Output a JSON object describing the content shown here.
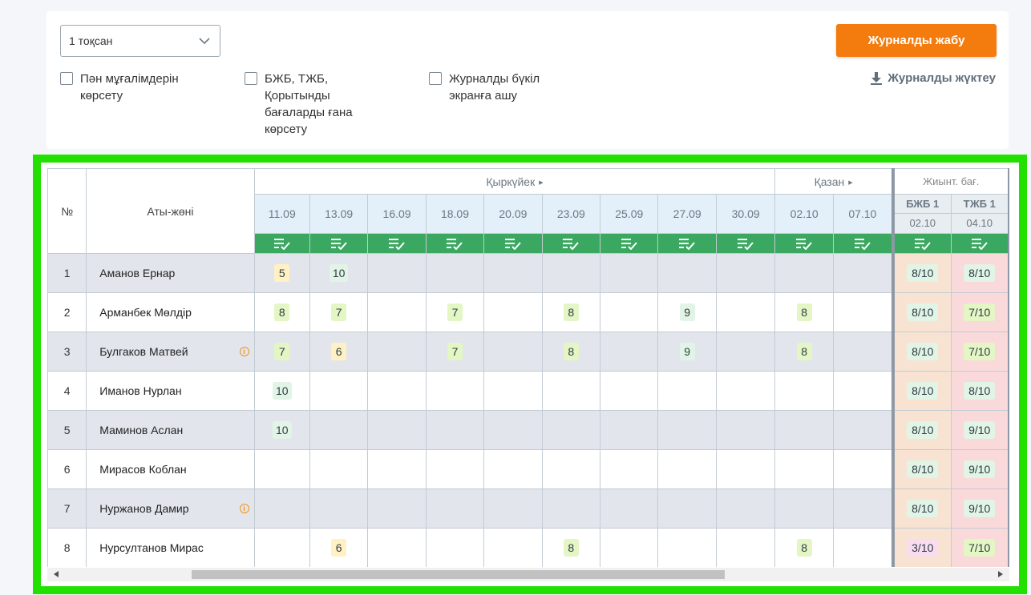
{
  "filters": {
    "quarter": "1 тоқсан",
    "checkboxes": [
      {
        "lines": [
          "Пән мұғалімдерін",
          "көрсету"
        ]
      },
      {
        "lines": [
          "БЖБ, ТЖБ,",
          "Қорытынды",
          "бағаларды ғана",
          "көрсету"
        ]
      },
      {
        "lines": [
          "Журналды бүкіл",
          "экранға ашу"
        ]
      }
    ],
    "close_label": "Журналды жабу",
    "download_label": "Журналды жүктеу"
  },
  "table": {
    "col_num": "№",
    "col_name": "Аты-жөні",
    "months": [
      "Қыркүйек",
      "Қазан"
    ],
    "dates": [
      "11.09",
      "13.09",
      "16.09",
      "18.09",
      "20.09",
      "23.09",
      "25.09",
      "27.09",
      "30.09",
      "02.10",
      "07.10"
    ],
    "summary_title": "Жиынт. бағ.",
    "summary_cols": [
      {
        "label": "БЖБ 1",
        "date": "02.10"
      },
      {
        "label": "ТЖБ 1",
        "date": "04.10"
      }
    ],
    "rows": [
      {
        "n": "1",
        "name": "Аманов Ернар",
        "info": false,
        "grades": [
          "5",
          "10",
          "",
          "",
          "",
          "",
          "",
          "",
          "",
          "",
          ""
        ],
        "bjb": "8/10",
        "tjb": "8/10"
      },
      {
        "n": "2",
        "name": "Арманбек Мөлдір",
        "info": false,
        "grades": [
          "8",
          "7",
          "",
          "7",
          "",
          "8",
          "",
          "9",
          "",
          "8",
          ""
        ],
        "bjb": "8/10",
        "tjb": "7/10"
      },
      {
        "n": "3",
        "name": "Булгаков Матвей",
        "info": true,
        "grades": [
          "7",
          "6",
          "",
          "7",
          "",
          "8",
          "",
          "9",
          "",
          "8",
          ""
        ],
        "bjb": "8/10",
        "tjb": "7/10"
      },
      {
        "n": "4",
        "name": "Иманов Нурлан",
        "info": false,
        "grades": [
          "10",
          "",
          "",
          "",
          "",
          "",
          "",
          "",
          "",
          "",
          ""
        ],
        "bjb": "8/10",
        "tjb": "8/10"
      },
      {
        "n": "5",
        "name": "Маминов Аслан",
        "info": false,
        "grades": [
          "10",
          "",
          "",
          "",
          "",
          "",
          "",
          "",
          "",
          "",
          ""
        ],
        "bjb": "8/10",
        "tjb": "9/10"
      },
      {
        "n": "6",
        "name": "Мирасов Коблан",
        "info": false,
        "grades": [
          "",
          "",
          "",
          "",
          "",
          "",
          "",
          "",
          "",
          "",
          ""
        ],
        "bjb": "8/10",
        "tjb": "9/10"
      },
      {
        "n": "7",
        "name": "Нуржанов Дамир",
        "info": true,
        "grades": [
          "",
          "",
          "",
          "",
          "",
          "",
          "",
          "",
          "",
          "",
          ""
        ],
        "bjb": "8/10",
        "tjb": "9/10"
      },
      {
        "n": "8",
        "name": "Нурсултанов Мирас",
        "info": false,
        "grades": [
          "",
          "6",
          "",
          "",
          "",
          "8",
          "",
          "",
          "",
          "8",
          ""
        ],
        "bjb": "3/10",
        "tjb": "7/10"
      }
    ]
  },
  "colors": {
    "accent_orange": "#f47b0d",
    "header_green": "#3aa860",
    "highlight_frame": "#22e000"
  }
}
